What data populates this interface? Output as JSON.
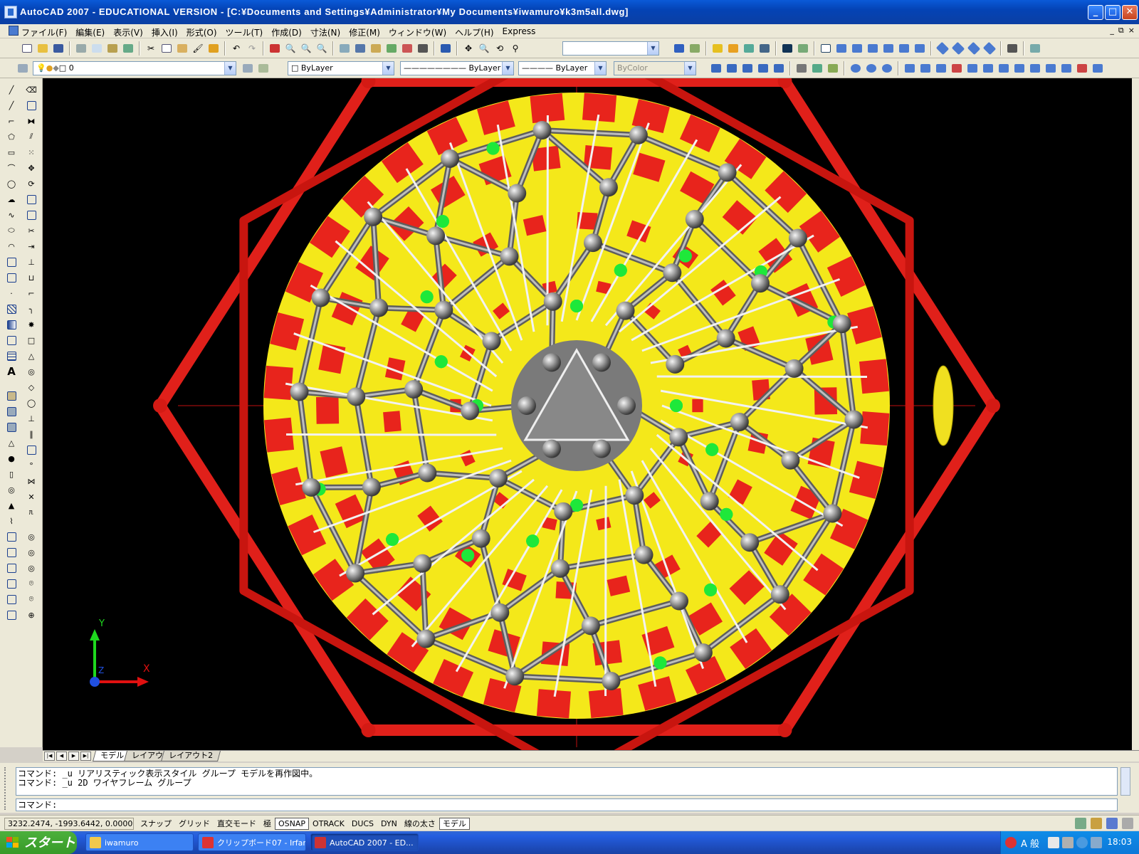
{
  "window": {
    "title": "AutoCAD 2007 - EDUCATIONAL VERSION - [C:¥Documents and Settings¥Administrator¥My Documents¥iwamuro¥k3m5all.dwg]",
    "minimize": "_",
    "maximize": "□",
    "close": "✕"
  },
  "menubar": {
    "items": [
      "ファイル(F)",
      "編集(E)",
      "表示(V)",
      "挿入(I)",
      "形式(O)",
      "ツール(T)",
      "作成(D)",
      "寸法(N)",
      "修正(M)",
      "ウィンドウ(W)",
      "ヘルプ(H)",
      "Express"
    ],
    "doc_controls": [
      "_",
      "⧉",
      "×"
    ]
  },
  "toolbar_properties": {
    "layer_value": "0",
    "color_value": "ByLayer",
    "linetype_value": "ByLayer",
    "lineweight_value": "ByLayer",
    "plotstyle_value": "ByColor"
  },
  "layout_tabs": [
    "モデル",
    "レイアウト1",
    "レイアウト2"
  ],
  "command": {
    "history": [
      "コマンド: _u リアリスティック表示スタイル グループ モデルを再作図中。",
      "コマンド: _u 2D ワイヤフレーム グループ"
    ],
    "prompt": "コマンド:"
  },
  "status": {
    "coordinates": "3232.2474,  -1993.6442, 0.0000",
    "toggles": [
      {
        "label": "スナップ",
        "on": false
      },
      {
        "label": "グリッド",
        "on": false
      },
      {
        "label": "直交モード",
        "on": false
      },
      {
        "label": "極",
        "on": false
      },
      {
        "label": "OSNAP",
        "on": true
      },
      {
        "label": "OTRACK",
        "on": false
      },
      {
        "label": "DUCS",
        "on": false
      },
      {
        "label": "DYN",
        "on": false
      },
      {
        "label": "線の太さ",
        "on": false
      },
      {
        "label": "モデル",
        "on": true
      }
    ]
  },
  "ucs": {
    "x": "X",
    "y": "Y",
    "z": "Z"
  },
  "taskbar": {
    "start": "スタート",
    "tasks": [
      {
        "label": "iwamuro",
        "icon": "folder-icon",
        "active": false
      },
      {
        "label": "クリップボード07 - Irfan...",
        "icon": "irfanview-icon",
        "active": false
      },
      {
        "label": "AutoCAD 2007 - ED...",
        "icon": "autocad-icon",
        "active": true
      }
    ],
    "ime": "A 般",
    "clock": "18:03"
  },
  "colors": {
    "titlebar": "#0a5ad8",
    "viewport_bg": "#000000",
    "frame_red": "#e0201a",
    "disc_yellow": "#f4e81a",
    "strut_gray": "#8c8c8c",
    "hub_green": "#1ee83a",
    "taskbar": "#245ee0",
    "start_green": "#3ea52d"
  }
}
